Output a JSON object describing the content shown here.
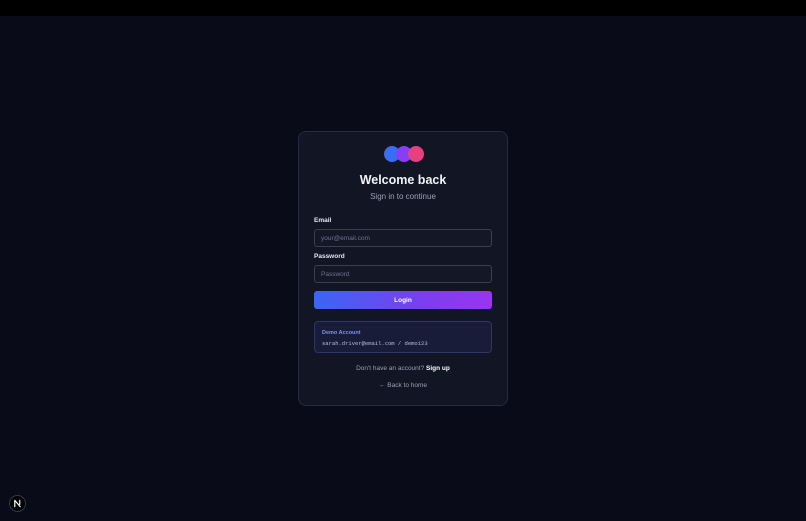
{
  "card": {
    "title": "Welcome back",
    "subtitle": "Sign in to continue"
  },
  "form": {
    "email_label": "Email",
    "email_placeholder": "your@email.com",
    "email_value": "",
    "password_label": "Password",
    "password_placeholder": "Password",
    "password_value": "",
    "login_label": "Login"
  },
  "demo": {
    "title": "Demo Account",
    "credentials": "sarah.driver@email.com / demo123"
  },
  "footer": {
    "signup_prompt": "Don't have an account?",
    "signup_link": "Sign up",
    "back_link": "← Back to home"
  },
  "colors": {
    "background": "#090b18",
    "card": "#121523",
    "accent_blue": "#3b6cf5",
    "accent_purple": "#8a3df2",
    "accent_pink": "#e5417f"
  },
  "icons": {
    "logo": "three-overlapping-circles-logo",
    "dev_badge": "n-letter-icon"
  }
}
